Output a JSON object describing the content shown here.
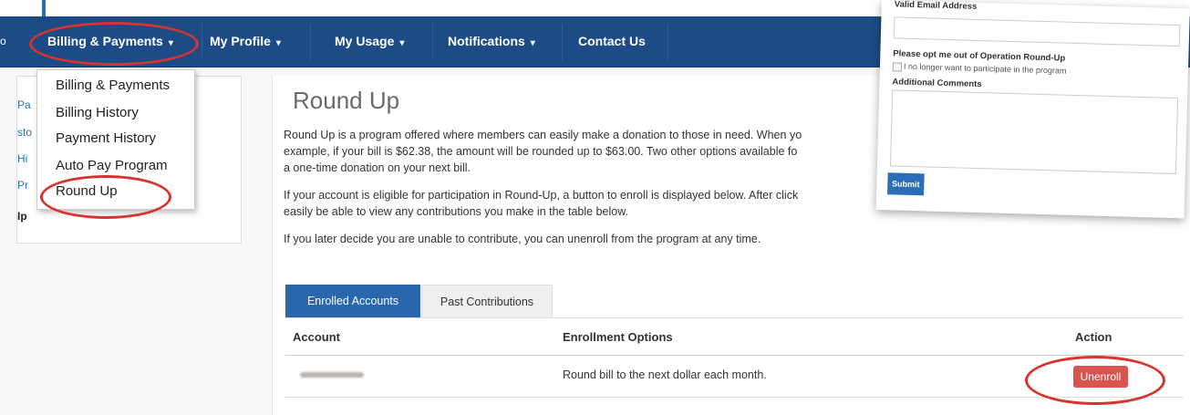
{
  "navbar": {
    "items": [
      {
        "label": "Billing & Payments",
        "caret": "▾"
      },
      {
        "label": "My Profile",
        "caret": "▾"
      },
      {
        "label": "My Usage",
        "caret": "▾"
      },
      {
        "label": "Notifications",
        "caret": "▾"
      },
      {
        "label": "Contact Us",
        "caret": ""
      }
    ],
    "left_edge": "o"
  },
  "sidebar": {
    "fragments": [
      "Pa",
      "sto",
      "Hi",
      "Pr",
      "Ip"
    ]
  },
  "dropdown": {
    "items": [
      "Billing & Payments",
      "Billing History",
      "Payment History",
      "Auto Pay Program",
      "Round Up"
    ]
  },
  "main": {
    "title": "Round Up",
    "paragraphs": [
      "Round Up is a program offered where members can easily make a donation to those in need. When yo",
      "example, if your bill is $62.38, the amount will be rounded up to $63.00. Two other options available fo",
      "a one-time donation on your next bill.",
      "If your account is eligible for participation in Round-Up, a button to enroll is displayed below. After click",
      "easily be able to view any contributions you make in the table below.",
      "If you later decide you are unable to contribute, you can unenroll from the program at any time."
    ],
    "tabs": [
      "Enrolled Accounts",
      "Past Contributions"
    ],
    "table": {
      "headers": [
        "Account",
        "Enrollment Options",
        "Action"
      ],
      "rows": [
        {
          "account": "",
          "option": "Round bill to the next dollar each month.",
          "action": "Unenroll"
        }
      ]
    }
  },
  "modal": {
    "email_label": "Valid Email Address",
    "optout_label": "Please opt me out of Operation Round-Up",
    "optout_checkbox": "I no longer want to participate in the program",
    "comments_label": "Additional Comments",
    "submit": "Submit"
  },
  "colors": {
    "nav": "#1d4b86",
    "primary": "#2a66ab",
    "danger": "#d9534f",
    "annotation": "#d5352e"
  }
}
